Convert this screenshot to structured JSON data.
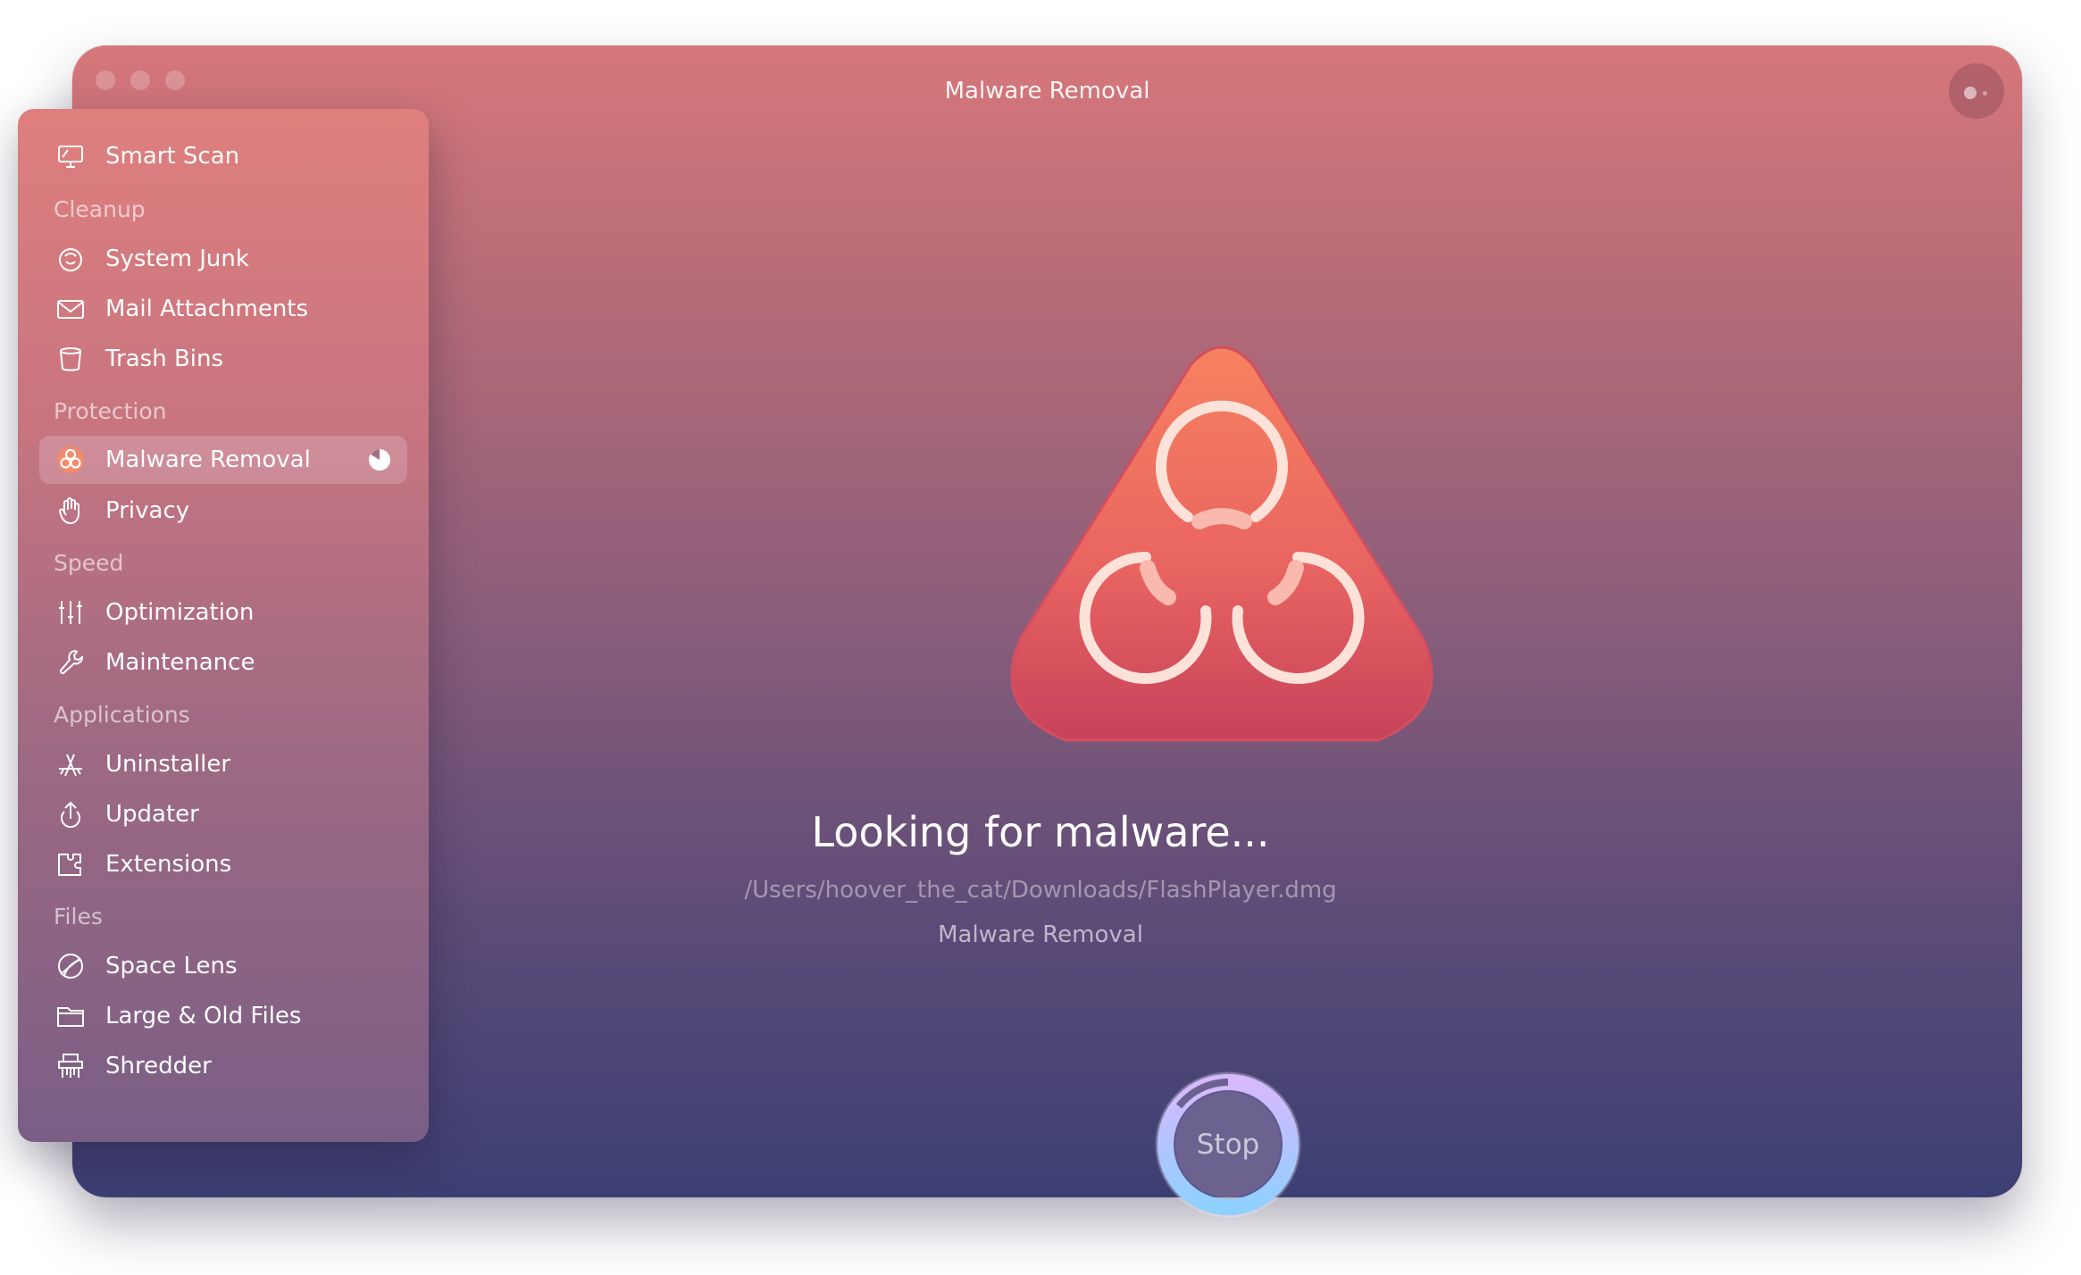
{
  "window": {
    "title": "Malware Removal"
  },
  "sidebar": {
    "smart_scan": "Smart Scan",
    "sections": {
      "cleanup": "Cleanup",
      "protection": "Protection",
      "speed": "Speed",
      "applications": "Applications",
      "files": "Files"
    },
    "items": {
      "system_junk": "System Junk",
      "mail_attachments": "Mail Attachments",
      "trash_bins": "Trash Bins",
      "malware_removal": "Malware Removal",
      "privacy": "Privacy",
      "optimization": "Optimization",
      "maintenance": "Maintenance",
      "uninstaller": "Uninstaller",
      "updater": "Updater",
      "extensions": "Extensions",
      "space_lens": "Space Lens",
      "large_old_files": "Large & Old Files",
      "shredder": "Shredder"
    },
    "active_item": "malware_removal"
  },
  "main": {
    "status": "Looking for malware...",
    "current_path": "/Users/hoover_the_cat/Downloads/FlashPlayer.dmg",
    "module": "Malware Removal",
    "stop_label": "Stop"
  },
  "colors": {
    "accent_hazard": "#f07a5e",
    "hazard_dark": "#c9405a",
    "progress_ring": "#b9b8ff"
  }
}
